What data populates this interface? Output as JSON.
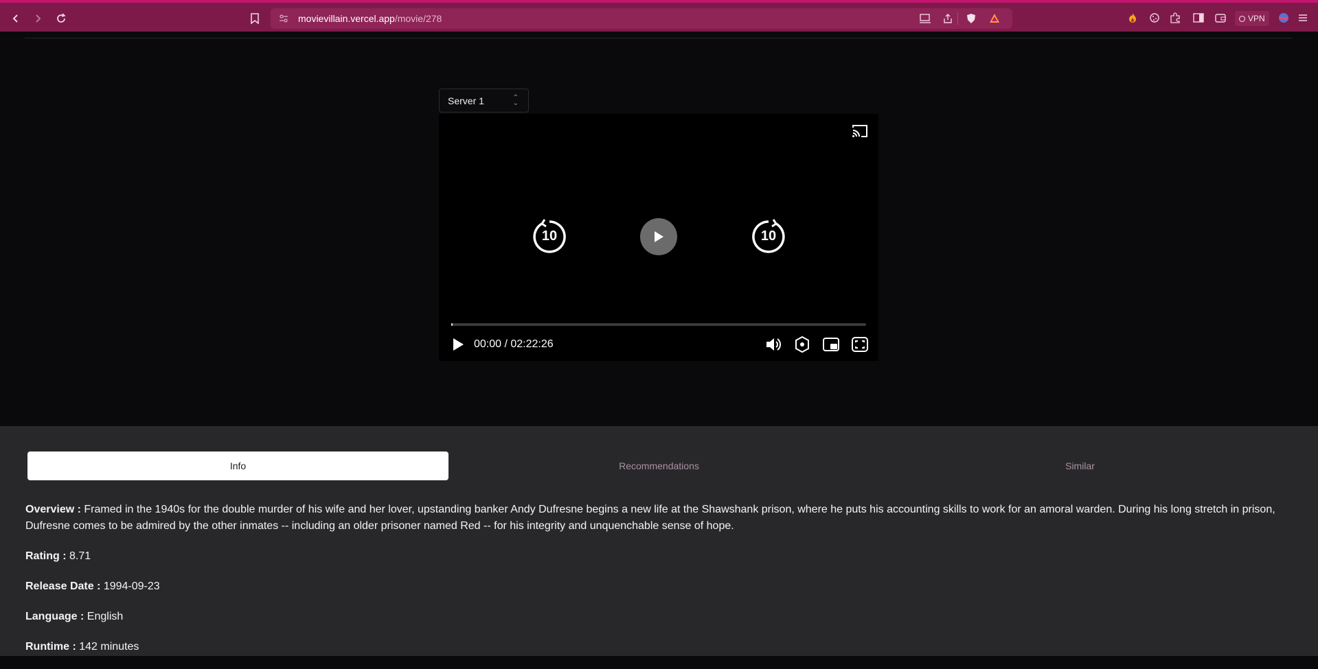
{
  "browser": {
    "url_host": "movievillain.vercel.app",
    "url_path": "/movie/278",
    "vpn_label": "VPN",
    "theme_color": "#7d1a4a"
  },
  "player": {
    "server_label": "Server 1",
    "skip_back_label": "10",
    "skip_forward_label": "10",
    "time_display": "00:00 / 02:22:26",
    "progress_fraction": 0.0
  },
  "tabs": [
    {
      "label": "Info"
    },
    {
      "label": "Recommendations"
    },
    {
      "label": "Similar"
    }
  ],
  "info": {
    "overview_label": "Overview :",
    "overview_text": " Framed in the 1940s for the double murder of his wife and her lover, upstanding banker Andy Dufresne begins a new life at the Shawshank prison, where he puts his accounting skills to work for an amoral warden. During his long stretch in prison, Dufresne comes to be admired by the other inmates -- including an older prisoner named Red -- for his integrity and unquenchable sense of hope.",
    "rating_label": "Rating :",
    "rating_value": " 8.71",
    "release_label": "Release Date :",
    "release_value": " 1994-09-23",
    "language_label": "Language :",
    "language_value": " English",
    "runtime_label": "Runtime :",
    "runtime_value": " 142 minutes"
  }
}
